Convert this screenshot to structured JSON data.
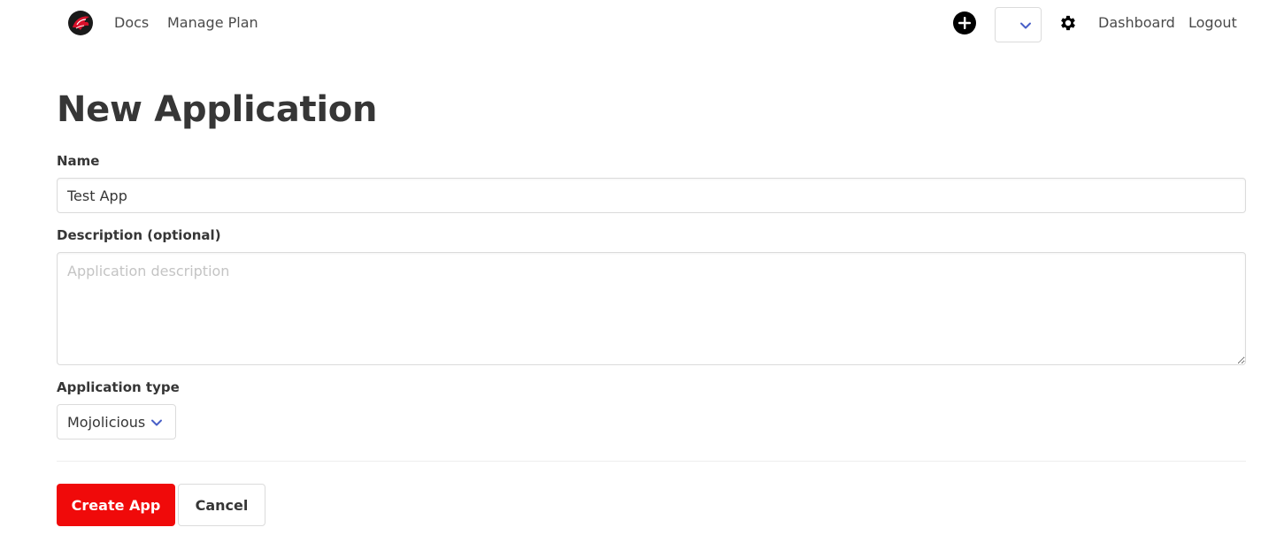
{
  "navbar": {
    "logo_icon": "phoenix-logo-icon",
    "links_left": [
      "Docs",
      "Manage Plan"
    ],
    "add_icon": "plus-circle-icon",
    "org_select_value": "",
    "settings_icon": "gear-icon",
    "links_right": [
      "Dashboard",
      "Logout"
    ]
  },
  "form": {
    "title": "New Application",
    "name_label": "Name",
    "name_value": "Test App",
    "description_label": "Description (optional)",
    "description_placeholder": "Application description",
    "description_value": "",
    "type_label": "Application type",
    "type_value": "Mojolicious",
    "create_label": "Create App",
    "cancel_label": "Cancel"
  },
  "colors": {
    "primary": "#f00a0a",
    "select_chevron": "#485fc7",
    "text": "#363636"
  }
}
